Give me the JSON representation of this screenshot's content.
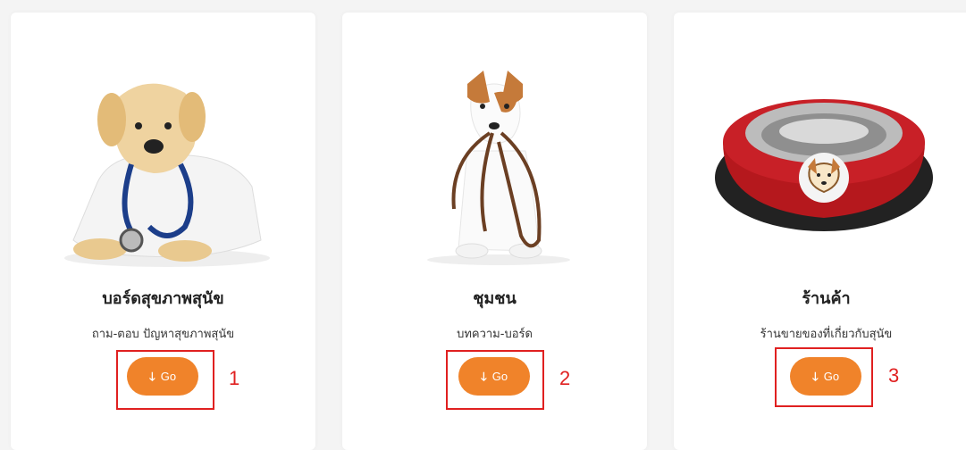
{
  "cards": [
    {
      "title": "บอร์ดสุขภาพสุนัข",
      "subtitle": "ถาม-ตอบ ปัญหาสุขภาพสุนัข",
      "button_label": "Go",
      "image_icon": "puppy-doctor-image"
    },
    {
      "title": "ชุมชน",
      "subtitle": "บทความ-บอร์ด",
      "button_label": "Go",
      "image_icon": "dog-with-leash-image"
    },
    {
      "title": "ร้านค้า",
      "subtitle": "ร้านขายของที่เกี่ยวกับสุนัข",
      "button_label": "Go",
      "image_icon": "dog-bowl-image"
    }
  ],
  "button_arrow": "🡓",
  "annotations": [
    "1",
    "2",
    "3"
  ],
  "colors": {
    "accent": "#f0832a",
    "annotation": "#e02020",
    "background": "#f4f4f4"
  }
}
